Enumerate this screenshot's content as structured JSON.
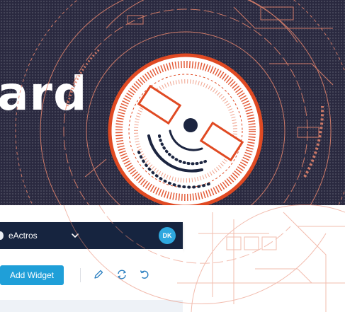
{
  "hero": {
    "title": "ard"
  },
  "topbar": {
    "workspace_name": "eActros",
    "avatar_initials": "DK"
  },
  "toolbar": {
    "add_widget_label": "Add Widget"
  },
  "icons": {
    "dropdown": "chevron-down-icon",
    "edit": "pencil-icon",
    "refresh": "refresh-icon",
    "undo": "undo-icon"
  },
  "colors": {
    "hero_background": "#2a2940",
    "emblem_orange": "#e04a23",
    "decoration_line": "#d98a7a",
    "navbar": "#16243f",
    "accent_blue": "#1f9fd8",
    "icon_blue": "#2a7fc0"
  }
}
